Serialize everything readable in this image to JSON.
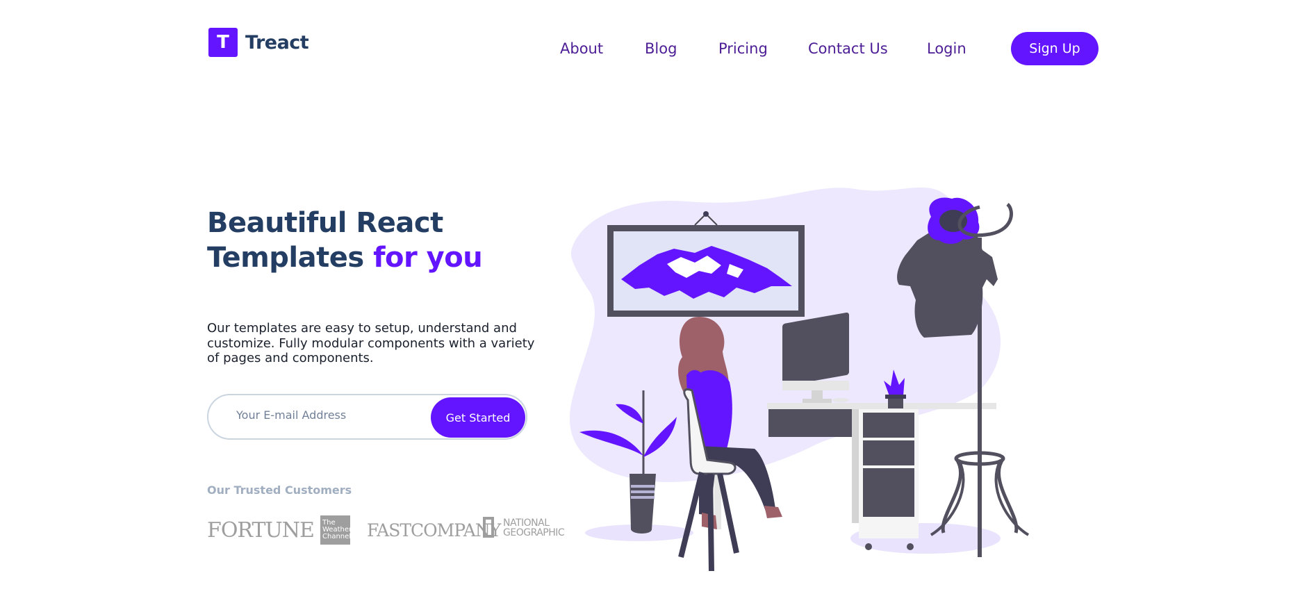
{
  "brand": {
    "logo_letter": "T",
    "name": "Treact",
    "accent": "#6415ff",
    "dark": "#243e63"
  },
  "nav": {
    "about": "About",
    "blog": "Blog",
    "pricing": "Pricing",
    "contact": "Contact Us",
    "login": "Login",
    "signup": "Sign Up"
  },
  "hero": {
    "headline_part1": "Beautiful React",
    "headline_part2": "Templates",
    "headline_accent": "for you",
    "description": "Our templates are easy to setup, understand and customize. Fully modular components with a variety of pages and components.",
    "email_placeholder": "Your E-mail Address",
    "cta_label": "Get Started"
  },
  "customers": {
    "title": "Our Trusted Customers",
    "fortune": "FORTUNE",
    "weather_line1": "The",
    "weather_line2": "Weather",
    "weather_line3": "Channel",
    "fastcompany": "FASTCOMPANY",
    "natgeo_line1": "NATIONAL",
    "natgeo_line2": "GEOGRAPHIC"
  },
  "illustration": {
    "icon": "woman-working-at-desk-illustration"
  }
}
